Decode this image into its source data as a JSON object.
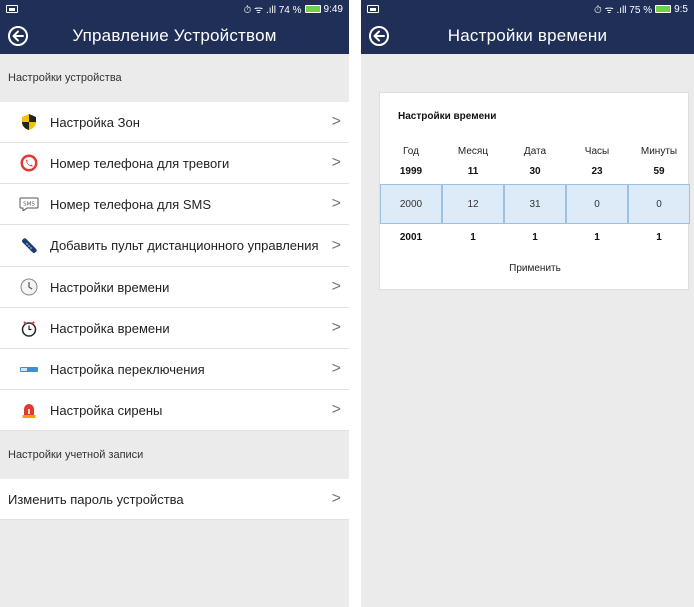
{
  "left_screen": {
    "status": {
      "right_text": "⏱ ᯤ .ıll 74 %",
      "time": "9:49"
    },
    "title": "Управление Устройством",
    "section1": "Настройки устройства",
    "items": [
      {
        "label": "Настройка Зон",
        "icon": "shield-icon"
      },
      {
        "label": "Номер телефона для тревоги",
        "icon": "phone-icon"
      },
      {
        "label": "Номер телефона для SMS",
        "icon": "sms-icon"
      },
      {
        "label": "Добавить пульт дистанционного управления",
        "icon": "remote-icon"
      },
      {
        "label": "Настройки времени",
        "icon": "clock-icon"
      },
      {
        "label": "Настройка времени",
        "icon": "stopwatch-icon"
      },
      {
        "label": "Настройка переключения",
        "icon": "switch-icon"
      },
      {
        "label": "Настройка сирены",
        "icon": "siren-icon"
      }
    ],
    "section2": "Настройки учетной записи",
    "account_item": "Изменить пароль устройства",
    "chevron": ">"
  },
  "right_screen": {
    "status": {
      "right_text": "⏱ ᯤ .ıll 75 %",
      "time": "9:5"
    },
    "title": "Настройки времени",
    "card_title": "Настройки времени",
    "columns": [
      "Год",
      "Месяц",
      "Дата",
      "Часы",
      "Минуты"
    ],
    "row_above": [
      "1999",
      "11",
      "30",
      "23",
      "59"
    ],
    "row_selected": [
      "2000",
      "12",
      "31",
      "0",
      "0"
    ],
    "row_below": [
      "2001",
      "1",
      "1",
      "1",
      "1"
    ],
    "apply_label": "Применить"
  },
  "colors": {
    "header": "#1f2f58",
    "selected_bg": "#dcebf7",
    "battery": "#6fd04b"
  }
}
